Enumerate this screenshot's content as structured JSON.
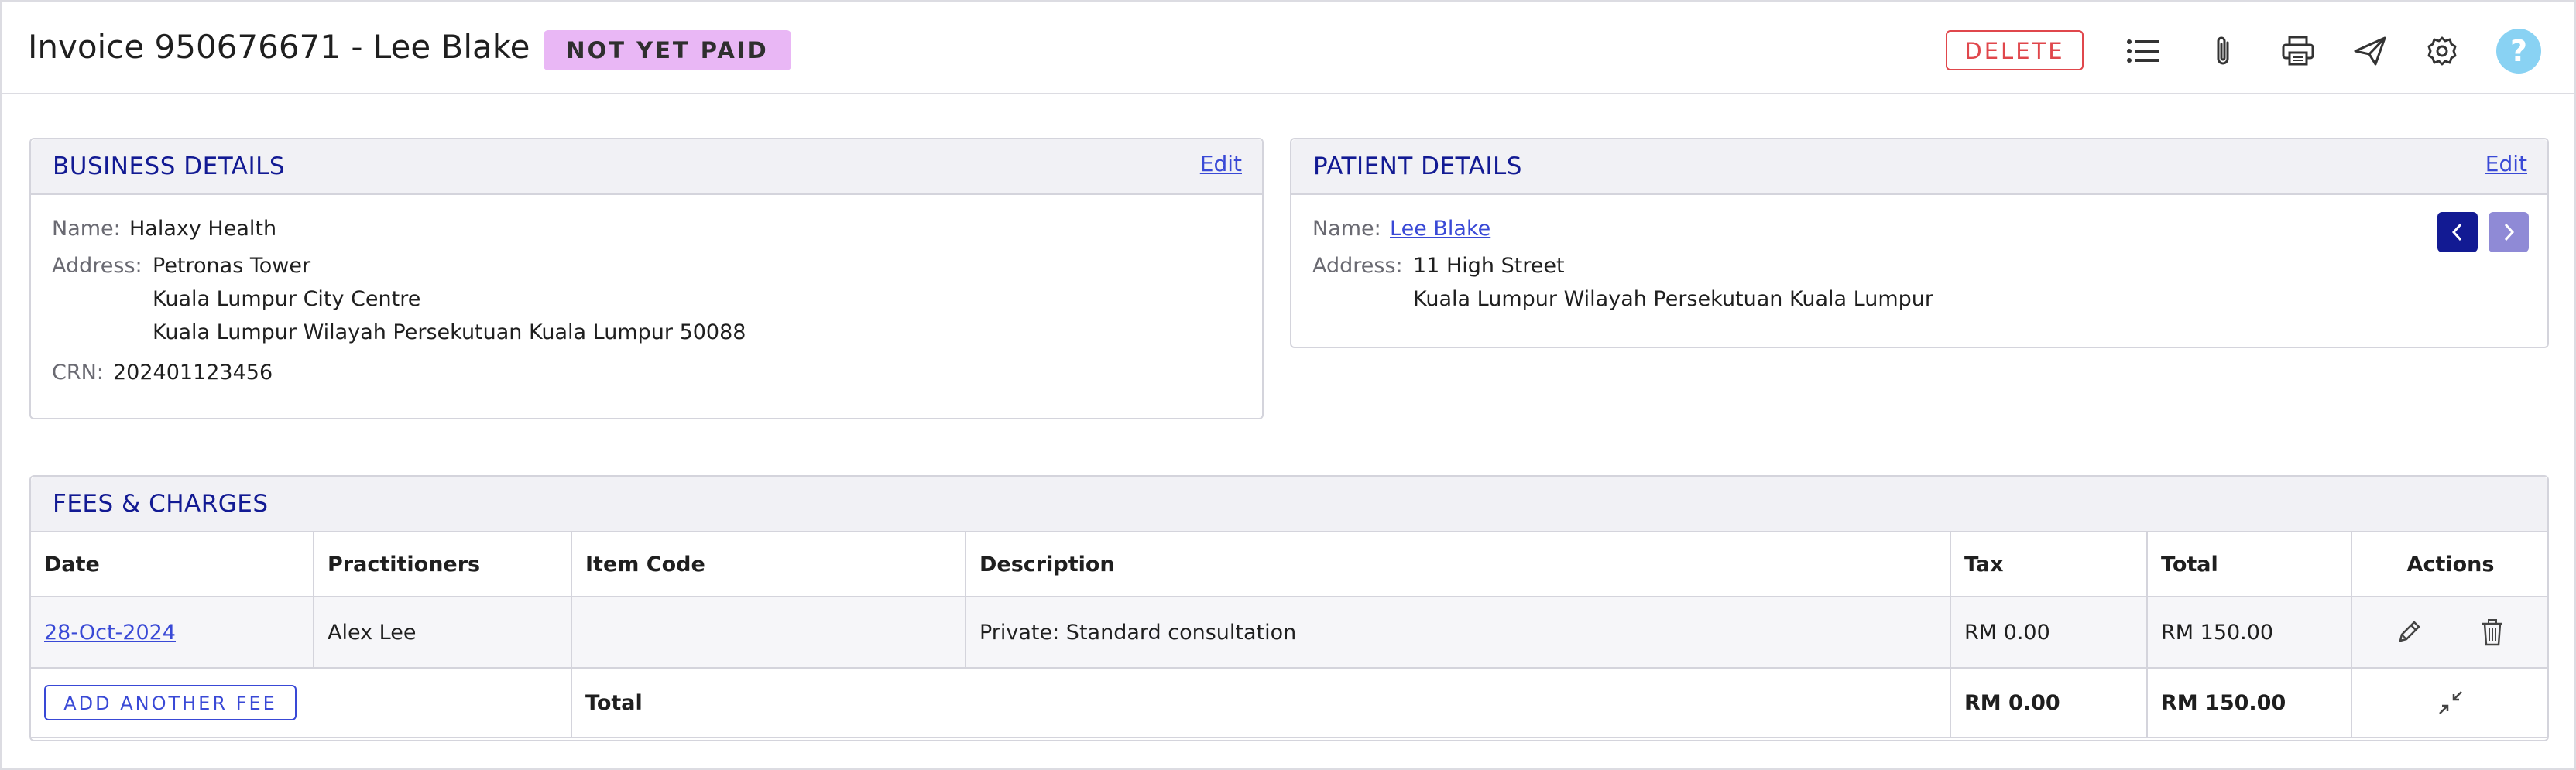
{
  "header": {
    "title": "Invoice 950676671 - Lee Blake",
    "status_badge": "NOT YET PAID",
    "delete_label": "DELETE",
    "help_label": "?",
    "icons": [
      "list-icon",
      "paperclip-icon",
      "printer-icon",
      "send-icon",
      "gear-icon",
      "help-icon"
    ]
  },
  "business": {
    "title": "BUSINESS DETAILS",
    "edit_label": "Edit",
    "name_label": "Name:",
    "name_value": "Halaxy Health",
    "address_label": "Address:",
    "address_lines": [
      "Petronas Tower",
      "Kuala Lumpur City Centre",
      "Kuala Lumpur Wilayah Persekutuan Kuala Lumpur 50088"
    ],
    "crn_label": "CRN:",
    "crn_value": "202401123456"
  },
  "patient": {
    "title": "PATIENT DETAILS",
    "edit_label": "Edit",
    "name_label": "Name:",
    "name_value": "Lee Blake",
    "address_label": "Address:",
    "address_lines": [
      "11 High Street",
      "Kuala Lumpur Wilayah Persekutuan Kuala Lumpur"
    ]
  },
  "fees": {
    "title": "FEES & CHARGES",
    "columns": [
      "Date",
      "Practitioners",
      "Item Code",
      "Description",
      "Tax",
      "Total",
      "Actions"
    ],
    "rows": [
      {
        "date": "28-Oct-2024",
        "practitioner": "Alex Lee",
        "item_code": "",
        "description": "Private: Standard consultation",
        "tax": "RM 0.00",
        "total": "RM 150.00"
      }
    ],
    "add_fee_label": "ADD ANOTHER FEE",
    "total_label": "Total",
    "total_tax": "RM 0.00",
    "total_amount": "RM 150.00"
  },
  "colors": {
    "accent": "#3949d6",
    "title_blue": "#121a93",
    "danger": "#e0474c",
    "badge_bg": "#e9b7f5",
    "help_bg": "#89d2f3",
    "nav_prev_bg": "#121a93",
    "nav_next_bg": "#8f8ad6"
  }
}
